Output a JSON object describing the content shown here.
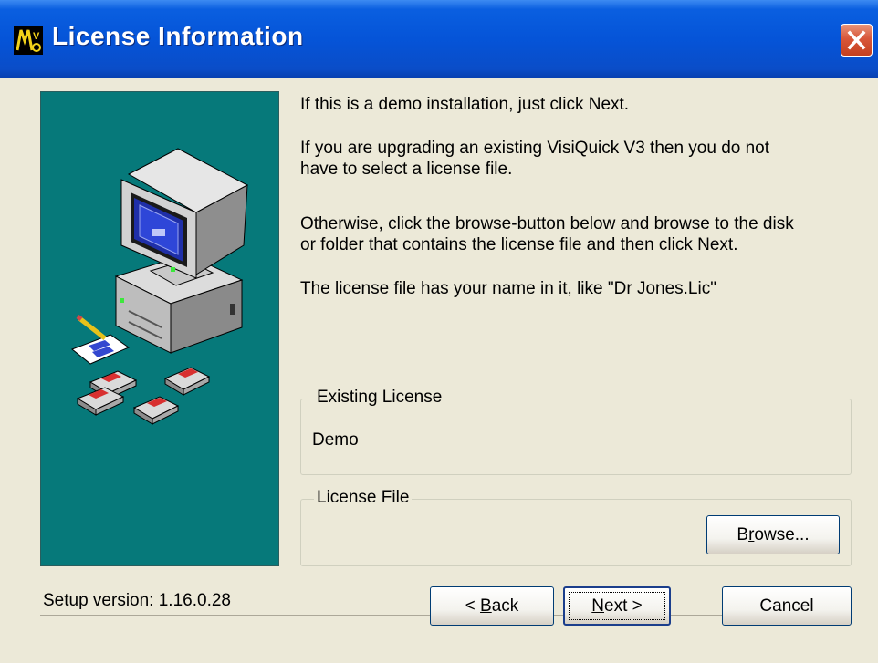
{
  "window": {
    "title": "License Information",
    "icon": "visiquick-app-icon"
  },
  "content": {
    "paragraphs": [
      "If this is a demo installation, just click Next.",
      "If you are upgrading an existing VisiQuick V3 then you do not",
      "have to select a license file.",
      "Otherwise, click the browse-button below and browse to the disk",
      "or folder that contains the license file and then click Next.",
      "The license file has your name in it, like \"Dr Jones.Lic\""
    ]
  },
  "existing_license": {
    "legend": "Existing License",
    "value": "Demo"
  },
  "license_file": {
    "legend": "License File",
    "browse_pre": "B",
    "browse_mnemonic": "r",
    "browse_post": "owse..."
  },
  "footer": {
    "version": "Setup version: 1.16.0.28",
    "back_pre": "< ",
    "back_mnemonic": "B",
    "back_post": "ack",
    "next_mnemonic": "N",
    "next_post": "ext >",
    "cancel": "Cancel"
  },
  "colors": {
    "titlebar": "#0554D8",
    "panel": "#06797A",
    "dialog_bg": "#ECE9D8",
    "close": "#D8573A"
  }
}
